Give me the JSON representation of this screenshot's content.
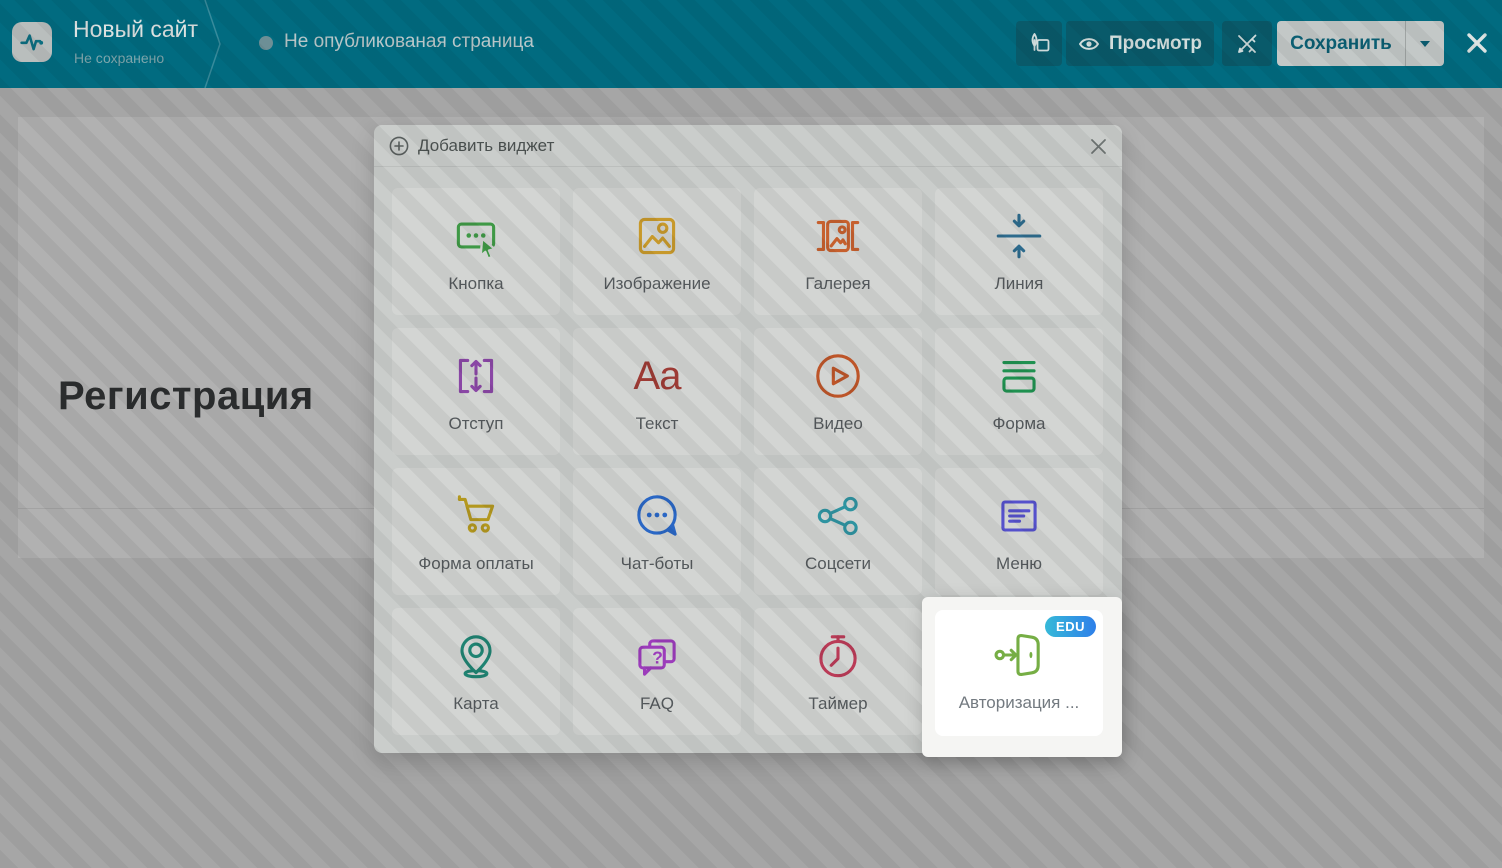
{
  "header": {
    "logo_icon": "pulse-icon",
    "site_title": "Новый сайт",
    "save_status": "Не сохранено",
    "page_status": "Не опубликованая страница",
    "preview_label": "Просмотр",
    "save_label": "Сохранить",
    "colors": {
      "bar": "#016b80",
      "button_dark": "#095a6a",
      "save_bg": "#c3c8c7",
      "save_text": "#0b5e72"
    }
  },
  "canvas": {
    "heading": "Регистрация"
  },
  "modal": {
    "title": "Добавить виджет",
    "widgets": [
      {
        "label": "Кнопка",
        "icon": "button-icon",
        "color": "#3f9946"
      },
      {
        "label": "Изображение",
        "icon": "image-icon",
        "color": "#c7992b"
      },
      {
        "label": "Галерея",
        "icon": "gallery-icon",
        "color": "#c6602e"
      },
      {
        "label": "Линия",
        "icon": "line-icon",
        "color": "#2d6b8d"
      },
      {
        "label": "Отступ",
        "icon": "spacing-icon",
        "color": "#8a47a5"
      },
      {
        "label": "Текст",
        "icon": "text-aa-icon",
        "color": "#9d3b35",
        "glyph": "Aa"
      },
      {
        "label": "Видео",
        "icon": "video-play-icon",
        "color": "#bd5529"
      },
      {
        "label": "Форма",
        "icon": "form-icon",
        "color": "#1f9150"
      },
      {
        "label": "Форма оплаты",
        "icon": "cart-icon",
        "color": "#b3981f"
      },
      {
        "label": "Чат-боты",
        "icon": "chat-bubble-icon",
        "color": "#2a67c5"
      },
      {
        "label": "Соцсети",
        "icon": "share-nodes-icon",
        "color": "#2f94a1"
      },
      {
        "label": "Меню",
        "icon": "menu-box-icon",
        "color": "#5551cc"
      },
      {
        "label": "Карта",
        "icon": "map-pin-icon",
        "color": "#1f8372"
      },
      {
        "label": "FAQ",
        "icon": "faq-bubbles-icon",
        "color": "#9c3cbb",
        "glyph": "?"
      },
      {
        "label": "Таймер",
        "icon": "stopwatch-icon",
        "color": "#ba3b57"
      },
      {
        "label": "Авторизация ...",
        "icon": "login-door-icon",
        "color": "#76ae45",
        "badge": "EDU",
        "highlighted": true
      }
    ]
  }
}
